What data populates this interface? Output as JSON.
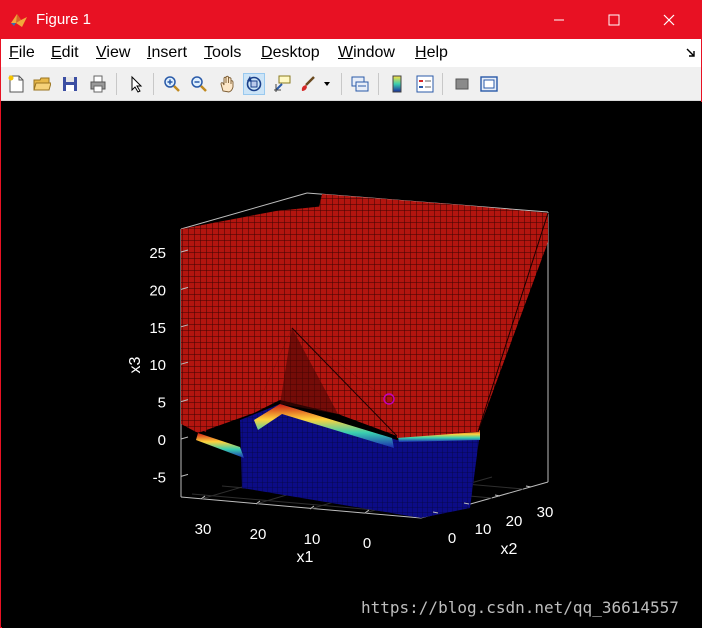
{
  "window": {
    "title": "Figure 1",
    "accent_color": "#e81123",
    "app_icon": "matlab-icon"
  },
  "menubar": {
    "items": [
      {
        "label": "File",
        "ul": "F",
        "rest": "ile"
      },
      {
        "label": "Edit",
        "ul": "E",
        "rest": "dit"
      },
      {
        "label": "View",
        "ul": "V",
        "rest": "iew"
      },
      {
        "label": "Insert",
        "ul": "I",
        "rest": "nsert"
      },
      {
        "label": "Tools",
        "ul": "T",
        "rest": "ools"
      },
      {
        "label": "Desktop",
        "ul": "D",
        "rest": "esktop"
      },
      {
        "label": "Window",
        "ul": "W",
        "rest": "indow"
      },
      {
        "label": "Help",
        "ul": "H",
        "rest": "elp"
      }
    ]
  },
  "toolbar": {
    "buttons": [
      "new-figure-icon",
      "open-file-icon",
      "save-icon",
      "print-icon",
      "edit-plot-arrow-icon",
      "zoom-in-icon",
      "zoom-out-icon",
      "pan-hand-icon",
      "rotate-3d-icon",
      "data-cursor-icon",
      "brush-icon",
      "brush-dropdown-icon",
      "link-plot-icon",
      "insert-colorbar-icon",
      "insert-legend-icon",
      "hide-plot-tools-icon",
      "show-plot-tools-icon"
    ]
  },
  "chart_data": {
    "type": "surface",
    "xlabel": "x1",
    "ylabel": "x2",
    "zlabel": "x3",
    "x_ticks": [
      "30",
      "20",
      "10",
      "0"
    ],
    "y_ticks": [
      "0",
      "10",
      "20",
      "30"
    ],
    "z_ticks": [
      "25",
      "20",
      "15",
      "10",
      "5",
      "0",
      "-5"
    ],
    "marker": {
      "shape": "circle",
      "color": "#c000c0"
    },
    "colors": {
      "high": "#cc1a12",
      "mid_edge": "#ffd23c",
      "low": "#0a0a8c",
      "axes": "#ffffff"
    }
  },
  "watermark": "https://blog.csdn.net/qq_36614557"
}
